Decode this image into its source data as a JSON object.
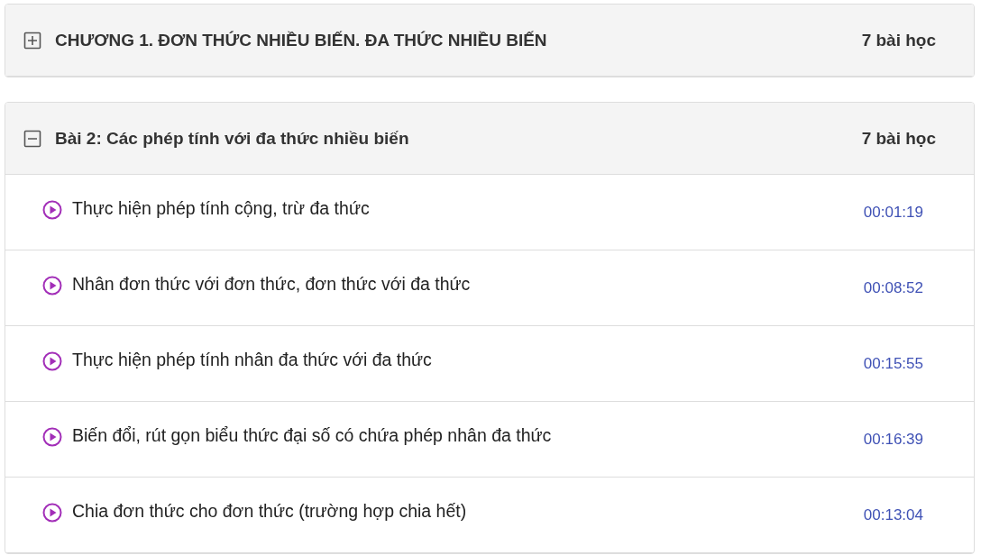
{
  "sections": [
    {
      "title": "CHƯƠNG 1. ĐƠN THỨC NHIỀU BIẾN. ĐA THỨC NHIỀU BIẾN",
      "count": "7 bài học",
      "expanded": false
    },
    {
      "title": "Bài 2: Các phép tính với đa thức nhiều biến",
      "count": "7 bài học",
      "expanded": true,
      "lessons": [
        {
          "title": "Thực hiện phép tính cộng, trừ đa thức",
          "duration": "00:01:19"
        },
        {
          "title": "Nhân đơn thức với đơn thức, đơn thức với đa thức",
          "duration": "00:08:52"
        },
        {
          "title": "Thực hiện phép tính nhân đa thức với đa thức",
          "duration": "00:15:55"
        },
        {
          "title": "Biến đổi, rút gọn biểu thức đại số có chứa phép nhân đa thức",
          "duration": "00:16:39"
        },
        {
          "title": "Chia đơn thức cho đơn thức (trường hợp chia hết)",
          "duration": "00:13:04"
        }
      ]
    }
  ]
}
